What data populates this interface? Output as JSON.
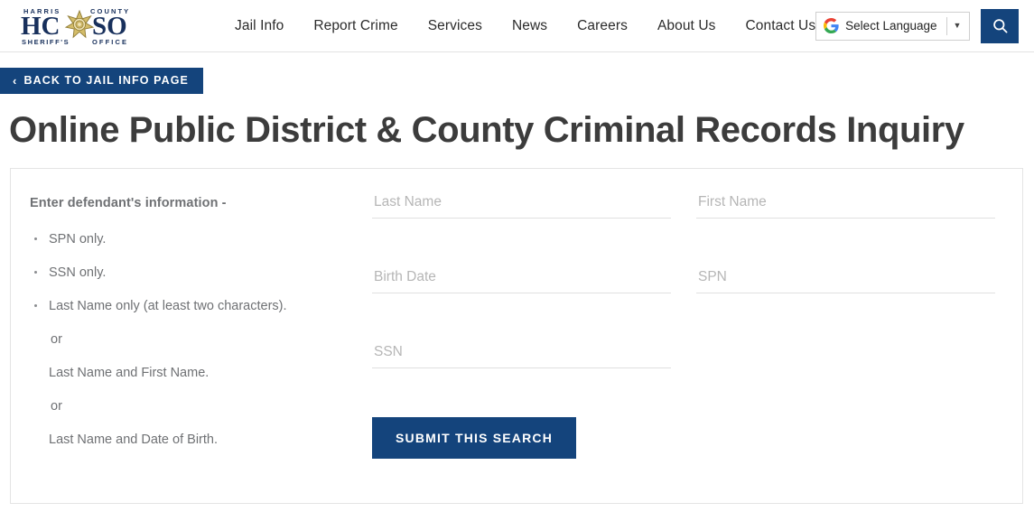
{
  "header": {
    "logo": {
      "top_text": "HARRIS COUNTY",
      "main_text": "HCSO",
      "bottom_text": "SHERIFF'S OFFICE",
      "alt": "Harris County Sheriff's Office"
    },
    "nav": [
      {
        "label": "Jail Info"
      },
      {
        "label": "Report Crime"
      },
      {
        "label": "Services"
      },
      {
        "label": "News"
      },
      {
        "label": "Careers"
      },
      {
        "label": "About Us"
      },
      {
        "label": "Contact Us"
      }
    ],
    "translate": {
      "label": "Select Language",
      "caret": "▼"
    },
    "search_button_icon": "search-icon"
  },
  "back_button": {
    "chevron": "‹",
    "label": "BACK TO JAIL INFO PAGE"
  },
  "page_title": "Online Public District & County Criminal Records Inquiry",
  "instructions": {
    "heading": "Enter defendant's information -",
    "items": [
      {
        "text": "SPN only.",
        "bulleted": true
      },
      {
        "text": "SSN only.",
        "bulleted": true
      },
      {
        "text": "Last Name only (at least two characters).",
        "bulleted": true
      },
      {
        "text": "or",
        "bulleted": false
      },
      {
        "text": "Last Name and First Name.",
        "bulleted": false
      },
      {
        "text": "or",
        "bulleted": false
      },
      {
        "text": "Last Name and Date of Birth.",
        "bulleted": false
      }
    ]
  },
  "form": {
    "fields": [
      {
        "name": "last-name",
        "placeholder": "Last Name",
        "value": ""
      },
      {
        "name": "first-name",
        "placeholder": "First Name",
        "value": ""
      },
      {
        "name": "birth-date",
        "placeholder": "Birth Date",
        "value": ""
      },
      {
        "name": "spn",
        "placeholder": "SPN",
        "value": ""
      },
      {
        "name": "ssn",
        "placeholder": "SSN",
        "value": ""
      }
    ],
    "submit_label": "SUBMIT THIS SEARCH"
  },
  "colors": {
    "navy": "#14447c",
    "title_gray": "#3c3c3c",
    "body_gray": "#6f7174",
    "placeholder_gray": "#b6b6b6",
    "border_gray": "#e4e4e4"
  }
}
